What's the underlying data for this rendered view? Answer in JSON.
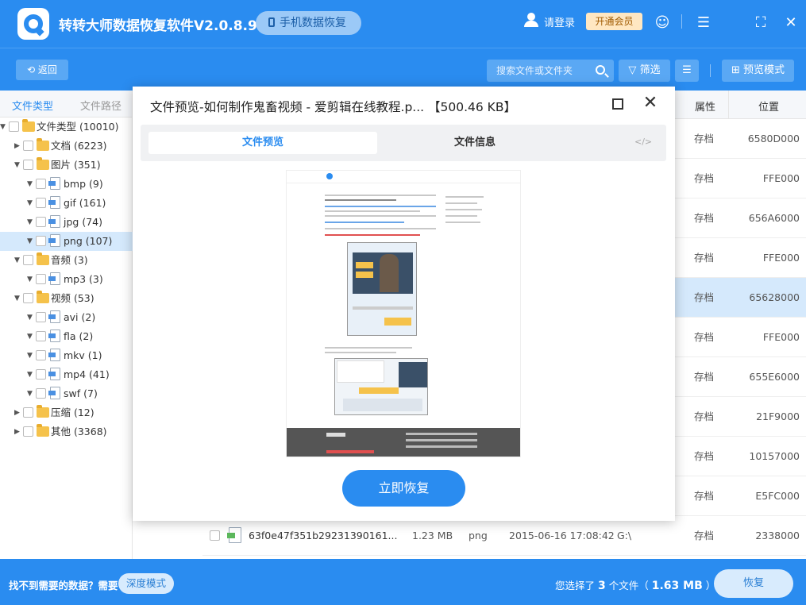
{
  "app": {
    "title": "转转大师数据恢复软件V2.0.8.9",
    "phone_button": "手机数据恢复",
    "login": "请登录",
    "vip_button": "开通会员",
    "window_icons": [
      "support-icon",
      "menu-icon",
      "fullscreen-icon",
      "close-icon"
    ]
  },
  "toolbar": {
    "back": "返回",
    "search_placeholder": "搜索文件或文件夹",
    "filter": "筛选",
    "preview_mode": "预览模式"
  },
  "sidebar": {
    "tabs": [
      "文件类型",
      "文件路径"
    ],
    "tree": [
      {
        "label": "文件类型 (10010)",
        "level": 0,
        "arrow": "down",
        "icon": "folder"
      },
      {
        "label": "文档 (6223)",
        "level": 1,
        "arrow": "right",
        "icon": "folder"
      },
      {
        "label": "图片 (351)",
        "level": 1,
        "arrow": "down",
        "icon": "folder"
      },
      {
        "label": "bmp (9)",
        "level": 2,
        "arrow": "down",
        "icon": "file"
      },
      {
        "label": "gif (161)",
        "level": 2,
        "arrow": "down",
        "icon": "file"
      },
      {
        "label": "jpg (74)",
        "level": 2,
        "arrow": "down",
        "icon": "file"
      },
      {
        "label": "png (107)",
        "level": 2,
        "arrow": "down",
        "icon": "file",
        "selected": true
      },
      {
        "label": "音频 (3)",
        "level": 1,
        "arrow": "down",
        "icon": "folder"
      },
      {
        "label": "mp3 (3)",
        "level": 2,
        "arrow": "down",
        "icon": "file"
      },
      {
        "label": "视频 (53)",
        "level": 1,
        "arrow": "down",
        "icon": "folder"
      },
      {
        "label": "avi (2)",
        "level": 2,
        "arrow": "down",
        "icon": "file"
      },
      {
        "label": "fla (2)",
        "level": 2,
        "arrow": "down",
        "icon": "file"
      },
      {
        "label": "mkv (1)",
        "level": 2,
        "arrow": "down",
        "icon": "file"
      },
      {
        "label": "mp4 (41)",
        "level": 2,
        "arrow": "down",
        "icon": "file"
      },
      {
        "label": "swf (7)",
        "level": 2,
        "arrow": "down",
        "icon": "file"
      },
      {
        "label": "压缩 (12)",
        "level": 1,
        "arrow": "right",
        "icon": "folder"
      },
      {
        "label": "其他 (3368)",
        "level": 1,
        "arrow": "right",
        "icon": "folder"
      }
    ]
  },
  "table": {
    "headers": {
      "attr": "属性",
      "position": "位置"
    },
    "rows": [
      {
        "attr": "存档",
        "position": "6580D000"
      },
      {
        "attr": "存档",
        "position": "FFE000"
      },
      {
        "attr": "存档",
        "position": "656A6000"
      },
      {
        "attr": "存档",
        "position": "FFE000"
      },
      {
        "attr": "存档",
        "position": "65628000",
        "selected": true
      },
      {
        "attr": "存档",
        "position": "FFE000"
      },
      {
        "attr": "存档",
        "position": "655E6000"
      },
      {
        "attr": "存档",
        "position": "21F9000"
      },
      {
        "attr": "存档",
        "position": "10157000"
      },
      {
        "attr": "存档",
        "position": "E5FC000"
      }
    ],
    "last_row": {
      "name": "63f0e47f351b29231390161...",
      "size": "1.23 MB",
      "type": "png",
      "time": "2015-06-16 17:08:42",
      "path": "G:\\",
      "attr": "存档",
      "position": "2338000"
    }
  },
  "modal": {
    "title": "文件预览-如何制作鬼畜视频 - 爱剪辑在线教程.p... 【500.46 KB】",
    "tab_preview": "文件预览",
    "tab_info": "文件信息",
    "code_icon": "</>",
    "restore_button": "立即恢复"
  },
  "footer": {
    "question": "找不到需要的数据？需要",
    "deep_mode": "深度模式",
    "selected_prefix": "您选择了",
    "selected_count": "3",
    "selected_mid": "个文件（",
    "selected_size": "1.63 MB",
    "selected_suffix": "）",
    "recover": "恢复"
  },
  "colors": {
    "primary": "#2a8cf0",
    "selected_row": "#d5e9fc",
    "vip_bg": "#ffe7c2"
  }
}
